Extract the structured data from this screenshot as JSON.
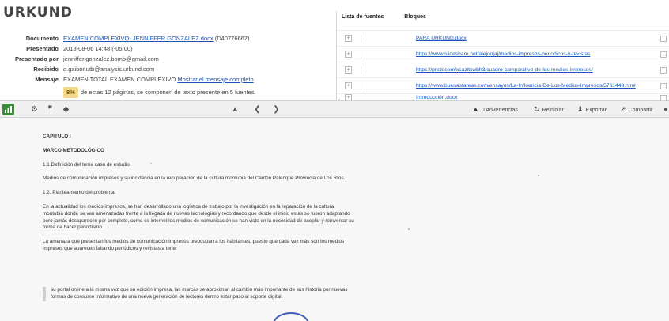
{
  "app": {
    "logo": "URKUND"
  },
  "meta": {
    "rows": [
      {
        "label": "Documento",
        "value": "EXAMEN COMPLEXIVO- JENNIFFER GONZALEZ.docx",
        "suffix": "(D40776667)",
        "is_link": true
      },
      {
        "label": "Presentado",
        "value": "2018-08-06 14:48 (-05:00)"
      },
      {
        "label": "Presentado por",
        "value": "jenniffer.gonzalez.bomb@gmail.com"
      },
      {
        "label": "Recibido",
        "value": "d.gaibor.utb@analysis.urkund.com"
      },
      {
        "label": "Mensaje",
        "value": "EXAMEN TOTAL EXAMEN COMPLEXIVO",
        "link": "Mostrar el mensaje completo"
      }
    ],
    "note_pct": "8%",
    "note_text": "de estas 12 páginas, se componen de texto presente en 5 fuentes."
  },
  "sources": {
    "header": [
      "Lista de fuentes",
      "Bloques"
    ],
    "rows": [
      {
        "text": "PARA URKUND.docx"
      },
      {
        "text": "https://www.slideshare.net/alejoojaj/medios-impresos-periodicos-y-revistas"
      },
      {
        "text": "https://prezi.com/xsazitcwbh3/cuadro-comparativo-de-los-medios-impresos/"
      },
      {
        "text": "https://www.buenastareas.com/ensayos/La-Influencia-De-Los-Medios-Impresos/5761448.html"
      },
      {
        "text": "Introducción.docx"
      }
    ]
  },
  "toolbar": {
    "icons": {
      "chart": "bar-chart-icon",
      "settings": "settings-icon",
      "quote": "quote-icon",
      "tag": "tag-icon",
      "up": "arrow-up-icon",
      "prev": "chevron-left-icon",
      "next": "chevron-right-icon"
    },
    "warnings_label": "0 Advertencias.",
    "reset_label": "Reiniciar",
    "export_label": "Exportar",
    "share_label": "Compartir"
  },
  "document": {
    "chapter": "CAPITULO I",
    "subchapter": "MARCO METODOLÓGICO",
    "h1": "1.1 Definición del tema caso de estudio.",
    "p1": "Medios de comunicación impresos y su incidencia en la recuperación de la cultura montubia del Cantón Palenque Provincia de Los Ríos.",
    "h2": "1.2. Planteamiento del problema.",
    "p2": "En la actualidad los medios impresos, se han desarrollado una logística de trabajo por la investigación en la reparación de la cultura montubia donde se ven amenazadas frente a la llegada de nuevas tecnologías y recordando que desde el inicio estas se fueron adaptando pero jamás desaparecen por completo, como es internet los medios de comunicación se han visto en la necesidad de acoplar y reinventar su forma de hacer periodismo.",
    "p3": "La amenaza que presentan los medios de comunicación impresos preocupan a los habitantes, puesto que cada vez más son los medios impresos que aparecen faltando periódicos y revistas a tener",
    "quote": "su portal online a la misma vez que su edición impresa, las marcas se aproximan al cambio más importante de sus historia por nuevas formas de consumo informativo de una nueva generación de lectores dentro estar paso al soporte digital."
  }
}
